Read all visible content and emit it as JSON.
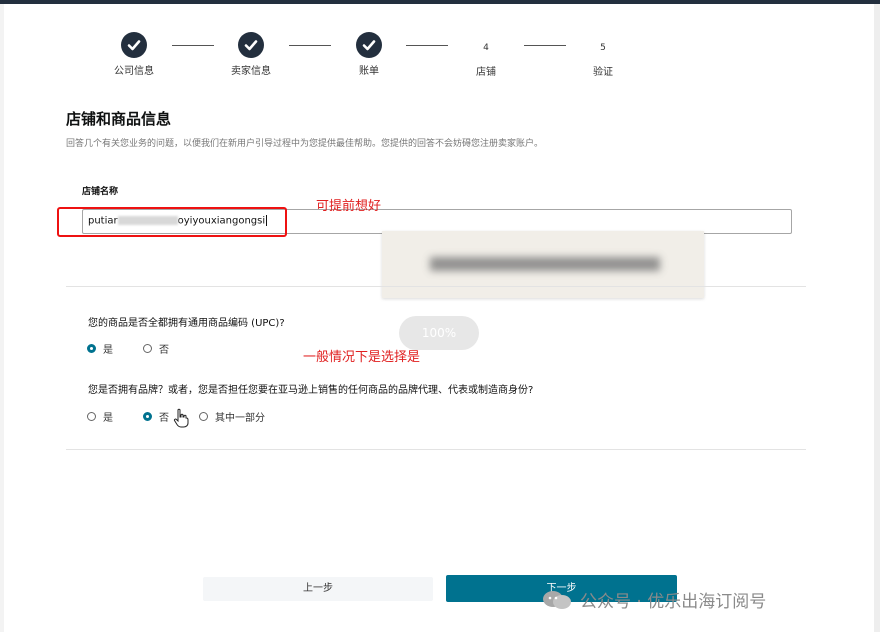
{
  "stepper": {
    "steps": [
      {
        "id": "1",
        "label": "公司信息",
        "state": "done"
      },
      {
        "id": "2",
        "label": "卖家信息",
        "state": "done"
      },
      {
        "id": "3",
        "label": "账单",
        "state": "done"
      },
      {
        "id": "4",
        "label": "店铺",
        "state": "current"
      },
      {
        "id": "5",
        "label": "验证",
        "state": "pending"
      }
    ]
  },
  "section": {
    "title": "店铺和商品信息",
    "description": "回答几个有关您业务的问题，以便我们在新用户引导过程中为您提供最佳帮助。您提供的回答不会妨碍您注册卖家账户。"
  },
  "store_name": {
    "label": "店铺名称",
    "value_start": "putiar",
    "value_end": "oyiyouxiangongsi"
  },
  "annotations": {
    "note_store": "可提前想好",
    "note_upc": "一般情况下是选择是"
  },
  "zoom_indicator": "100%",
  "upc_question": {
    "text": "您的商品是否全都拥有通用商品编码 (UPC)?",
    "options": [
      {
        "label": "是",
        "selected": true
      },
      {
        "label": "否",
        "selected": false
      }
    ]
  },
  "brand_question": {
    "text": "您是否拥有品牌？或者，您是否担任您要在亚马逊上销售的任何商品的品牌代理、代表或制造商身份?",
    "options": [
      {
        "label": "是",
        "selected": false
      },
      {
        "label": "否",
        "selected": true
      },
      {
        "label": "其中一部分",
        "selected": false
      }
    ]
  },
  "buttons": {
    "back": "上一步",
    "next": "下一步"
  },
  "watermark": "公众号 · 优乐出海订阅号",
  "colors": {
    "accent": "#00728f",
    "step_done": "#232f3e",
    "annotation_red": "#e02020"
  }
}
